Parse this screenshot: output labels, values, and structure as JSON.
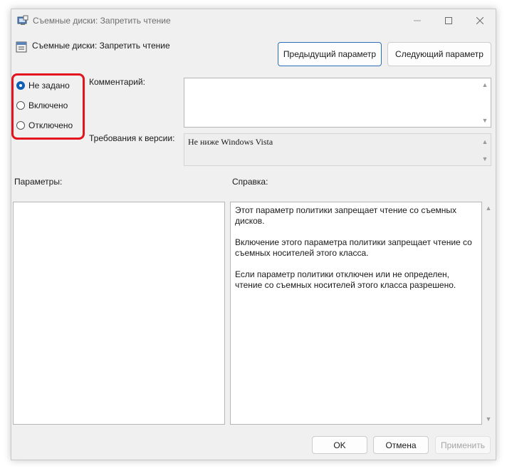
{
  "window": {
    "title": "Съемные диски: Запретить чтение"
  },
  "header": {
    "title": "Съемные диски: Запретить чтение"
  },
  "nav": {
    "prev_label": "Предыдущий параметр",
    "next_label": "Следующий параметр"
  },
  "state": {
    "options": [
      {
        "label": "Не задано",
        "checked": true
      },
      {
        "label": "Включено",
        "checked": false
      },
      {
        "label": "Отключено",
        "checked": false
      }
    ]
  },
  "comment": {
    "label": "Комментарий:",
    "value": ""
  },
  "supported": {
    "label": "Требования к версии:",
    "value": "Не ниже Windows Vista"
  },
  "options_panel": {
    "label": "Параметры:"
  },
  "help": {
    "label": "Справка:",
    "text": "Этот параметр политики запрещает чтение со съемных дисков.\n\nВключение этого параметра политики запрещает чтение со съемных носителей этого класса.\n\nЕсли параметр политики отключен или не определен, чтение со съемных носителей этого класса разрешено."
  },
  "footer": {
    "ok_label": "OK",
    "cancel_label": "Отмена",
    "apply_label": "Применить"
  },
  "highlight_color": "#e3141d",
  "accent_color": "#0f5fb6",
  "icons": {
    "window": "policy-window-icon",
    "header": "policy-setting-icon"
  }
}
